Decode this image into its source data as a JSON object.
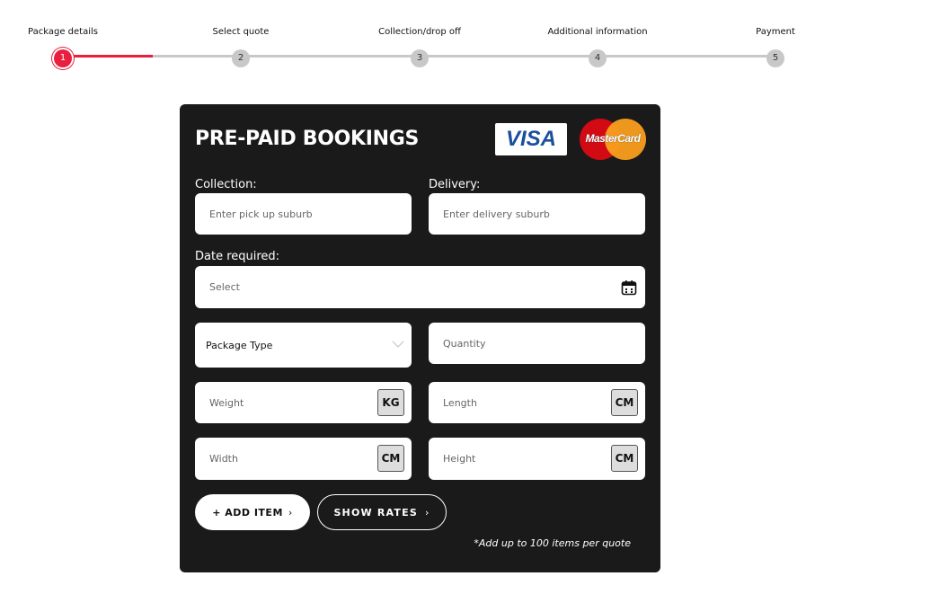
{
  "steps": [
    {
      "label": "Package details",
      "num": "1"
    },
    {
      "label": "Select quote",
      "num": "2"
    },
    {
      "label": "Collection/drop off",
      "num": "3"
    },
    {
      "label": "Additional information",
      "num": "4"
    },
    {
      "label": "Payment",
      "num": "5"
    }
  ],
  "current_step": 1,
  "colors": {
    "accent": "#e8203e",
    "card": "#1a1a1a"
  },
  "card": {
    "title": "PRE-PAID BOOKINGS",
    "visa": "VISA",
    "mastercard": "MasterCard"
  },
  "form": {
    "collection_label": "Collection:",
    "collection_placeholder": "Enter pick up suburb",
    "delivery_label": "Delivery:",
    "delivery_placeholder": "Enter delivery suburb",
    "date_label": "Date required:",
    "date_placeholder": "Select",
    "package_type": "Package Type",
    "quantity_placeholder": "Quantity",
    "weight_placeholder": "Weight",
    "weight_unit": "KG",
    "length_placeholder": "Length",
    "length_unit": "CM",
    "width_placeholder": "Width",
    "width_unit": "CM",
    "height_placeholder": "Height",
    "height_unit": "CM"
  },
  "buttons": {
    "add_item": "+ ADD ITEM",
    "show_rates": "SHOW RATES"
  },
  "note": "*Add up to 100 items per quote"
}
